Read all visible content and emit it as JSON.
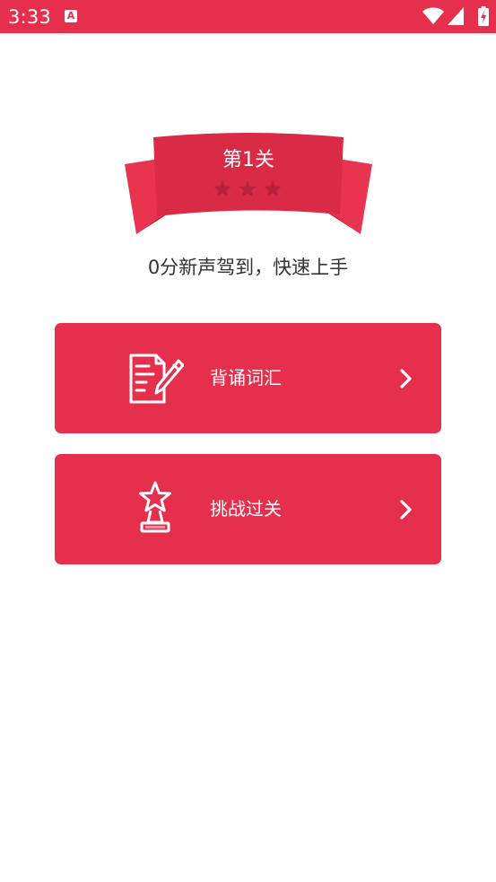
{
  "status_bar": {
    "time": "3:33",
    "app_icon_letter": "A",
    "icons": [
      "wifi-icon",
      "signal-icon",
      "battery-charging-icon"
    ]
  },
  "level": {
    "title": "第1关",
    "stars_total": 3,
    "stars_earned": 0
  },
  "subtitle": "0分新声驾到，快速上手",
  "menu": [
    {
      "label": "背诵词汇",
      "icon": "notepad-pen-icon"
    },
    {
      "label": "挑战过关",
      "icon": "star-trophy-icon"
    }
  ],
  "colors": {
    "accent": "#e52f4c",
    "banner_main": "#d92a46",
    "banner_tail": "#e8344f",
    "banner_shadow": "#b81f38",
    "star_empty": "#b8213a",
    "background": "#ffffff",
    "text": "#333333"
  }
}
